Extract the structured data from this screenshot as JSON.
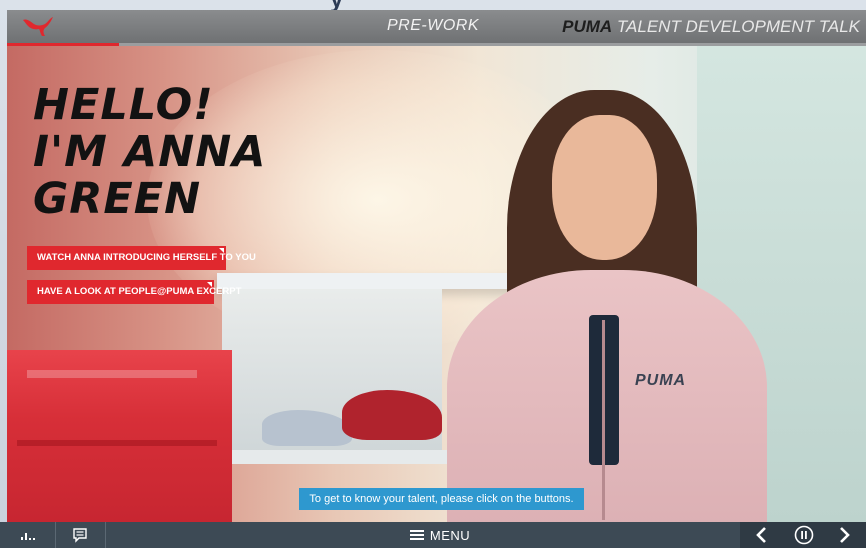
{
  "outer": {
    "title_fragment": "y"
  },
  "topbar": {
    "section": "PRE-WORK",
    "brand_bold": "PUMA",
    "brand_rest": " TALENT DEVELOPMENT TALK",
    "progress_fraction": 0.13
  },
  "scene": {
    "jacket_logo": "PUMA"
  },
  "heading": {
    "line1": "HELLO!",
    "line2": "I'M ANNA",
    "line3": "GREEN"
  },
  "buttons": {
    "watch": "WATCH ANNA INTRODUCING HERSELF TO YOU",
    "excerpt": "HAVE A LOOK AT PEOPLE@PUMA EXCERPT"
  },
  "hint": "To get to know your talent, please click on the buttons.",
  "bottombar": {
    "stats_icon": "bar-chart-icon",
    "notes_icon": "comment-icon",
    "menu_label": "MENU",
    "menu_icon": "hamburger-icon",
    "prev_icon": "chevron-left-icon",
    "pause_icon": "pause-icon",
    "next_icon": "chevron-right-icon"
  },
  "colors": {
    "accent_red": "#e0282e",
    "hint_blue": "#2e98cf",
    "bottombar": "#3d4a55"
  }
}
